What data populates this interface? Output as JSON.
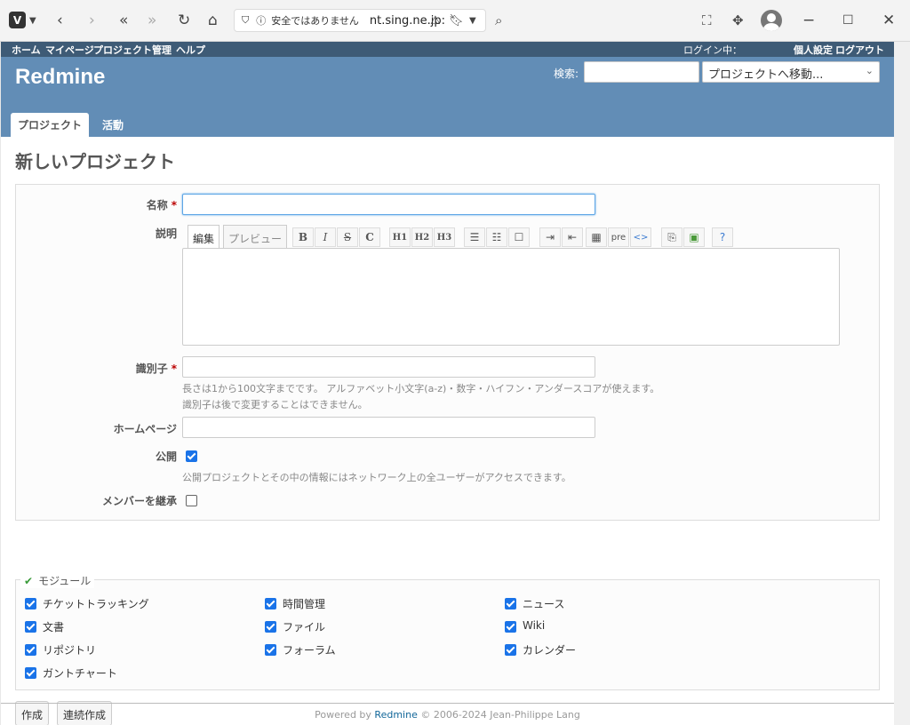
{
  "browser": {
    "security_warning": "安全ではありません",
    "url": "nt.sing.ne.jp:"
  },
  "top_menu": {
    "home": "ホーム",
    "my_page": "マイページ",
    "projects": "プロジェクト",
    "admin": "管理",
    "help": "ヘルプ",
    "logged_in": "ログイン中：",
    "my_account": "個人設定",
    "logout": "ログアウト"
  },
  "header": {
    "app_title": "Redmine",
    "search_label": "検索:",
    "jump_placeholder": "プロジェクトへ移動..."
  },
  "tabs": [
    {
      "label": "プロジェクト",
      "selected": true
    },
    {
      "label": "活動",
      "selected": false
    }
  ],
  "page_title": "新しいプロジェクト",
  "form": {
    "name_label": "名称",
    "description_label": "説明",
    "editor_tabs": {
      "edit": "編集",
      "preview": "プレビュー"
    },
    "toolbar": [
      "B",
      "I",
      "S",
      "C",
      "H1",
      "H2",
      "H3",
      "ul",
      "ol",
      "task",
      "indent",
      "outdent",
      "table",
      "pre",
      "code",
      "link",
      "image",
      "help"
    ],
    "identifier_label": "識別子",
    "identifier_hint_1": "長さは1から100文字までです。 アルファベット小文字(a-z)・数字・ハイフン・アンダースコアが使えます。",
    "identifier_hint_2": "識別子は後で変更することはできません。",
    "homepage_label": "ホームページ",
    "public_label": "公開",
    "public_checked": true,
    "public_hint": "公開プロジェクトとその中の情報にはネットワーク上の全ユーザーがアクセスできます。",
    "inherit_label": "メンバーを継承",
    "inherit_checked": false
  },
  "modules": {
    "legend": "モジュール",
    "items": [
      {
        "label": "チケットトラッキング",
        "checked": true
      },
      {
        "label": "時間管理",
        "checked": true
      },
      {
        "label": "ニュース",
        "checked": true
      },
      {
        "label": "文書",
        "checked": true
      },
      {
        "label": "ファイル",
        "checked": true
      },
      {
        "label": "Wiki",
        "checked": true
      },
      {
        "label": "リポジトリ",
        "checked": true
      },
      {
        "label": "フォーラム",
        "checked": true
      },
      {
        "label": "カレンダー",
        "checked": true
      },
      {
        "label": "ガントチャート",
        "checked": true
      }
    ]
  },
  "buttons": {
    "create": "作成",
    "create_continue": "連続作成"
  },
  "footer": {
    "prefix": "Powered by",
    "link": "Redmine",
    "suffix": "© 2006-2024 Jean-Philippe Lang"
  }
}
